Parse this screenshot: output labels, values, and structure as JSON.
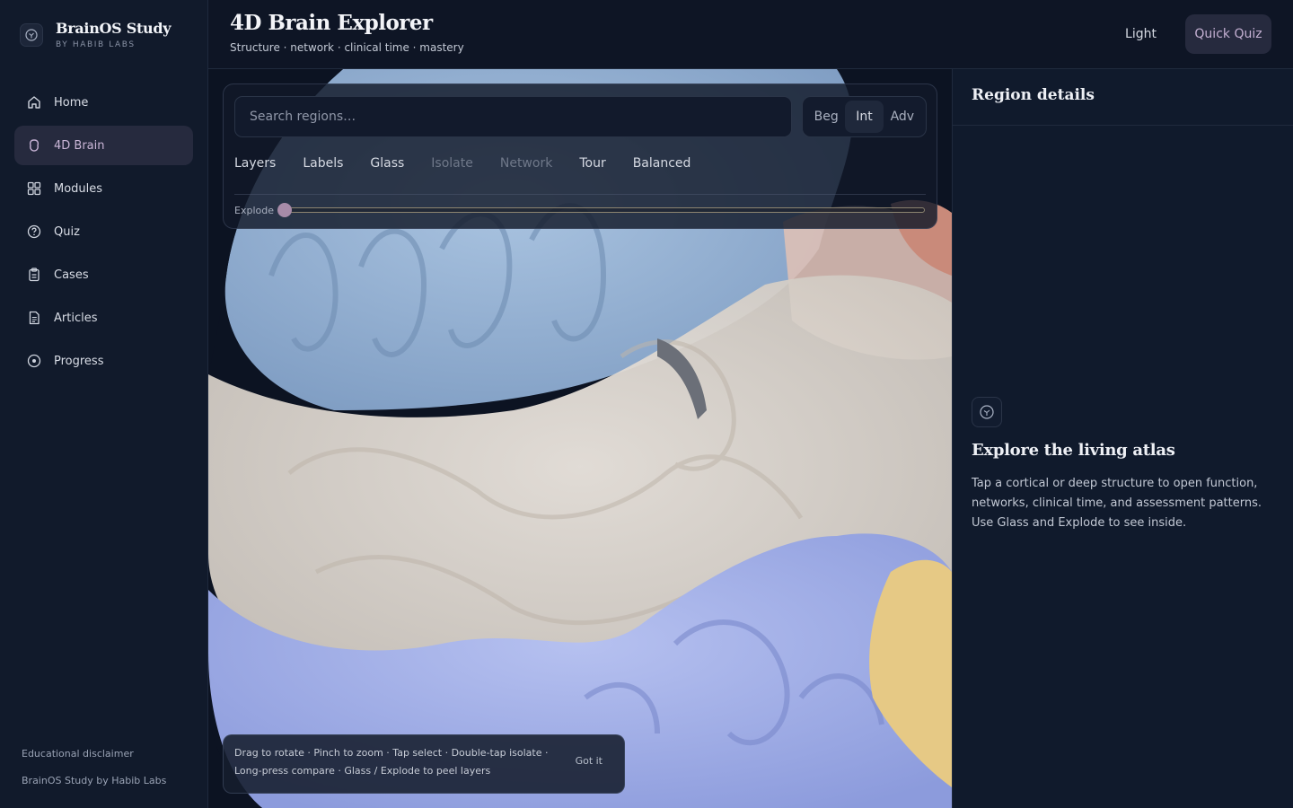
{
  "brand": {
    "title": "BrainOS Study",
    "subtitle": "BY HABIB LABS",
    "icon": "brain-logo-icon"
  },
  "sidebar": {
    "items": [
      {
        "label": "Home",
        "icon": "home-icon",
        "active": false
      },
      {
        "label": "4D Brain",
        "icon": "brain-outline-icon",
        "active": true
      },
      {
        "label": "Modules",
        "icon": "grid-icon",
        "active": false
      },
      {
        "label": "Quiz",
        "icon": "help-circle-icon",
        "active": false
      },
      {
        "label": "Cases",
        "icon": "clipboard-icon",
        "active": false
      },
      {
        "label": "Articles",
        "icon": "document-icon",
        "active": false
      },
      {
        "label": "Progress",
        "icon": "target-icon",
        "active": false
      }
    ],
    "footer": {
      "disclaimer": "Educational disclaimer",
      "credit": "BrainOS Study by Habib Labs"
    }
  },
  "header": {
    "title": "4D Brain Explorer",
    "subtitle": "Structure · network · clinical time · mastery",
    "theme_label": "Light",
    "quiz_label": "Quick Quiz"
  },
  "controls": {
    "search_placeholder": "Search regions…",
    "levels": [
      {
        "label": "Beg",
        "selected": false
      },
      {
        "label": "Int",
        "selected": true
      },
      {
        "label": "Adv",
        "selected": false
      }
    ],
    "tools": [
      {
        "label": "Layers",
        "enabled": true
      },
      {
        "label": "Labels",
        "enabled": true
      },
      {
        "label": "Glass",
        "enabled": true
      },
      {
        "label": "Isolate",
        "enabled": false
      },
      {
        "label": "Network",
        "enabled": false
      },
      {
        "label": "Tour",
        "enabled": true
      },
      {
        "label": "Balanced",
        "enabled": true
      }
    ],
    "explode_label": "Explode",
    "explode_value": 0
  },
  "hint": {
    "text": "Drag to rotate · Pinch to zoom · Tap select · Double-tap isolate · Long-press compare · Glass / Explode to peel layers",
    "dismiss_label": "Got it"
  },
  "details": {
    "title": "Region details",
    "empty_title": "Explore the living atlas",
    "empty_body": "Tap a cortical or deep structure to open function, networks, clinical time, and assessment patterns. Use Glass and Explode to see inside."
  },
  "colors": {
    "accent": "#c4b0d2",
    "background": "#0e1525",
    "panel": "#101a2c",
    "frontal_lobe": "#9bb6d6",
    "parietal_glass": "#e4dcd2",
    "temporal_lobe": "#a9b6e8",
    "occipital": "#e8cc8a"
  }
}
